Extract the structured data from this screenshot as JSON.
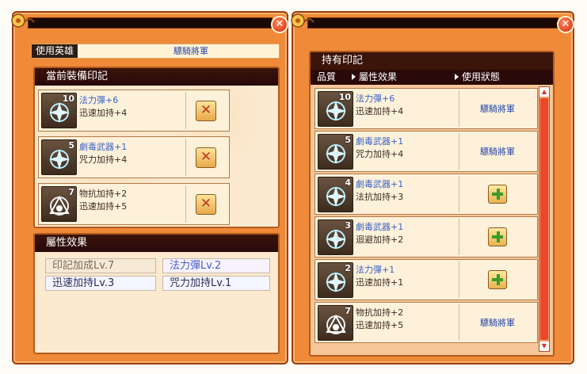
{
  "left_panel": {
    "hero_label": "使用英雄",
    "hero_value": "驃騎將軍",
    "equipped_title": "當前裝備印記",
    "equipped": [
      {
        "level": "10",
        "name": "法力彈+6",
        "effect": "迅速加持+4",
        "icon": "compass-star-icon"
      },
      {
        "level": "5",
        "name": "劇毒武器+1",
        "effect": "咒力加持+4",
        "icon": "compass-star-icon"
      },
      {
        "level": "7",
        "name": "物抗加持+2",
        "effect": "迅速加持+5",
        "icon": "triangle-rune-icon"
      }
    ],
    "attr_title": "屬性效果",
    "attrs": [
      "印記加成Lv.7",
      "法力彈Lv.2",
      "迅速加持Lv.3",
      "咒力加持Lv.1"
    ]
  },
  "right_panel": {
    "title": "持有印記",
    "columns": [
      "品質",
      "屬性效果",
      "使用狀態"
    ],
    "rows": [
      {
        "level": "10",
        "name": "法力彈+6",
        "effect": "迅速加持+4",
        "state": "驃騎將軍",
        "icon": "compass-star-icon"
      },
      {
        "level": "5",
        "name": "劇毒武器+1",
        "effect": "咒力加持+4",
        "state": "驃騎將軍",
        "icon": "compass-star-icon"
      },
      {
        "level": "4",
        "name": "劇毒武器+1",
        "effect": "法抗加持+3",
        "state": "",
        "icon": "compass-star-icon"
      },
      {
        "level": "3",
        "name": "劇毒武器+1",
        "effect": "迴避加持+2",
        "state": "",
        "icon": "compass-star-icon"
      },
      {
        "level": "2",
        "name": "法力彈+1",
        "effect": "迅速加持+1",
        "state": "",
        "icon": "compass-star-icon"
      },
      {
        "level": "7",
        "name": "物抗加持+2",
        "effect": "迅速加持+5",
        "state": "驃騎將軍",
        "icon": "triangle-rune-icon"
      }
    ]
  },
  "colors": {
    "panel": "#ef8a38",
    "header": "#2a0a08",
    "accent_blue": "#2747a8"
  }
}
